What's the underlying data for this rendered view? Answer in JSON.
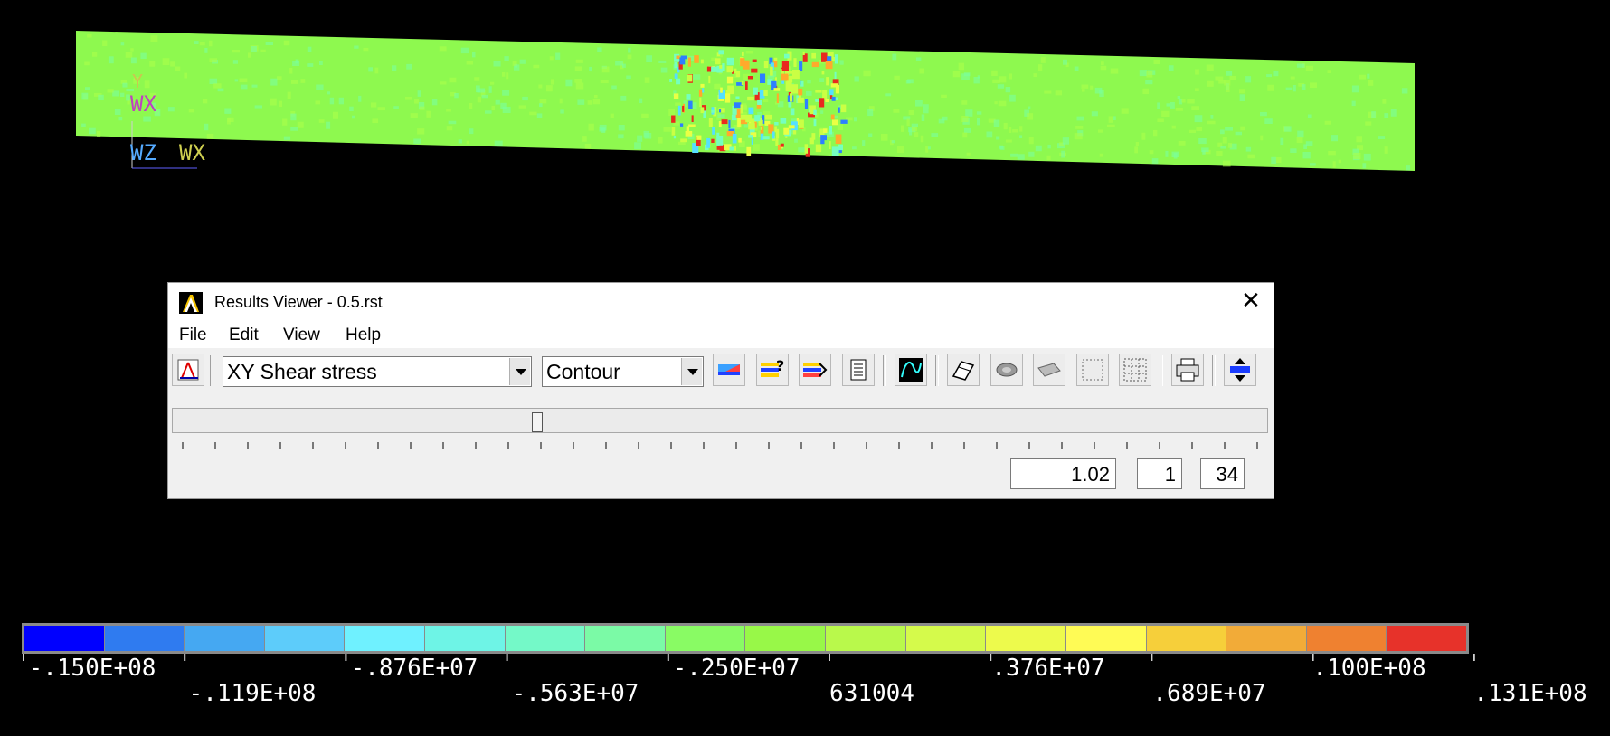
{
  "plot": {
    "triad_labels": [
      "Y",
      "WX",
      "WZ",
      "WX"
    ],
    "contour_colors": [
      "#0000ff",
      "#2d7fff",
      "#3fbfff",
      "#55e0ff",
      "#6affff",
      "#70ffdf",
      "#75ffbf",
      "#7aff9f",
      "#8dff52",
      "#aaff4b",
      "#caff44",
      "#eaff44",
      "#ffff44",
      "#ffd12e",
      "#ffaa2c",
      "#f28021",
      "#e82a1e"
    ]
  },
  "window": {
    "title": "Results Viewer -  0.5.rst",
    "menu": [
      "File",
      "Edit",
      "View",
      "Help"
    ],
    "result_item": "XY Shear stress",
    "plot_style": "Contour",
    "time_value": "1.02",
    "set_number": "1",
    "set_count": "34",
    "toolbar_icons": [
      "triad-icon",
      "contour-plot-icon",
      "query-icon",
      "animate-icon",
      "list-results-icon",
      "graph-icon",
      "eraser-icon",
      "cap-surface-icon",
      "slice-icon",
      "grid-dots-icon",
      "grid-fine-icon",
      "print-icon",
      "viewer-settings-icon"
    ]
  },
  "legend": {
    "labels": [
      ".150E+08",
      "-.119E+08",
      "-.876E+07",
      "-.563E+07",
      "-.250E+07",
      "631004",
      ".376E+07",
      ".689E+07",
      ".100E+08",
      ".131E+08"
    ],
    "first_label_prefix": "-",
    "colors": [
      "#0000ff",
      "#2f7bf0",
      "#45a8f2",
      "#5dccfa",
      "#6ff1ff",
      "#6ef4e6",
      "#74f9c8",
      "#7bfaa6",
      "#89fb64",
      "#98f848",
      "#b9f94b",
      "#d5fa4b",
      "#edfa4c",
      "#fffb55",
      "#f6cf3a",
      "#f2ab38",
      "#ef8130",
      "#e7322a"
    ]
  }
}
